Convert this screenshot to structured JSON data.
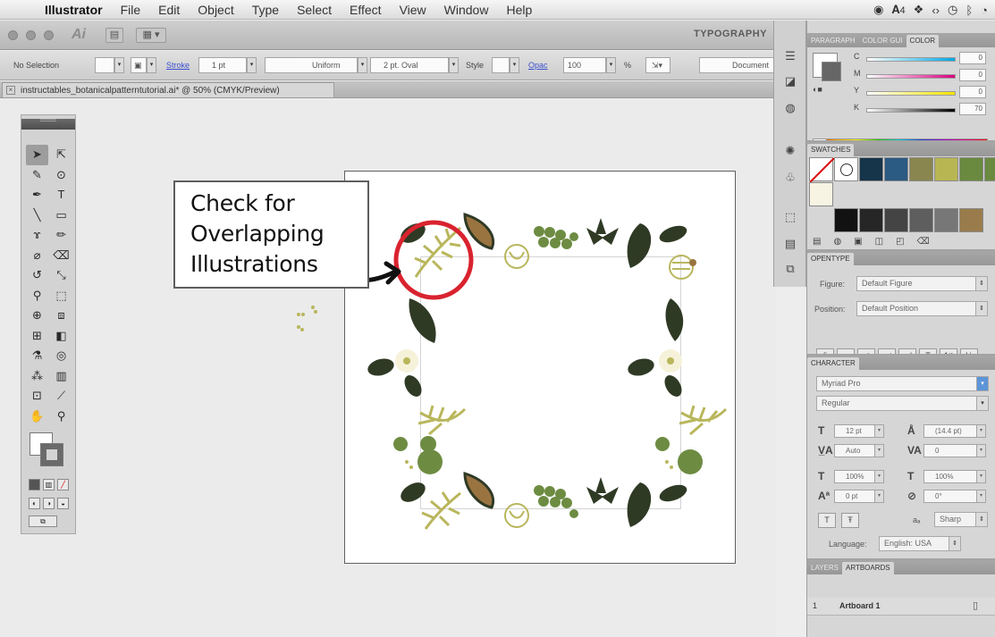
{
  "menubar": {
    "items": [
      "Illustrator",
      "File",
      "Edit",
      "Object",
      "Type",
      "Select",
      "Effect",
      "View",
      "Window",
      "Help"
    ],
    "tray_badge": "4"
  },
  "appbar": {
    "logo": "Ai",
    "workspace": "TYPOGRAPHY"
  },
  "control_bar": {
    "selection": "No Selection",
    "stroke_label": "Stroke",
    "stroke_weight": "1 pt",
    "profile": "Uniform",
    "brush": "2 pt. Oval",
    "style_label": "Style",
    "opacity_label": "Opac",
    "opacity_value": "100",
    "percent": "%",
    "document_button": "Document"
  },
  "document": {
    "tab_title": "instructables_botanicalpatterntutorial.ai* @ 50% (CMYK/Preview)"
  },
  "callout": {
    "lines": [
      "Check for",
      "Overlapping",
      "Illustrations"
    ]
  },
  "panels": {
    "top_tabs": [
      "PARAGRAPH",
      "COLOR GUI",
      "COLOR"
    ],
    "color": {
      "channels": [
        {
          "label": "C",
          "value": "0",
          "position": 0.0
        },
        {
          "label": "M",
          "value": "0",
          "position": 0.0
        },
        {
          "label": "Y",
          "value": "0",
          "position": 0.0
        },
        {
          "label": "K",
          "value": "70",
          "position": 0.7
        }
      ]
    },
    "swatches": {
      "title": "SWATCHES",
      "colors": [
        "#ffffff",
        "#2e3420",
        "#16344a",
        "#2b5a82",
        "#8a8650",
        "#b7b652",
        "#6a8a3f",
        "#f7f4e3",
        "#d7d7d7",
        "#121212",
        "#262626",
        "#444444",
        "#5e5e5e",
        "#777777",
        "#9a7c4c"
      ]
    },
    "opentype": {
      "title": "OPENTYPE",
      "figure_label": "Figure:",
      "figure_value": "Default Figure",
      "position_label": "Position:",
      "position_value": "Default Position"
    },
    "character": {
      "title": "CHARACTER",
      "font_family": "Myriad Pro",
      "font_style": "Regular",
      "size": "12 pt",
      "leading": "(14.4 pt)",
      "kerning": "Auto",
      "tracking": "0",
      "vscale": "100%",
      "hscale": "100%",
      "baseline": "0 pt",
      "rotation": "0°",
      "aa": "Sharp",
      "aa_label": "aₐ",
      "language_label": "Language:",
      "language": "English: USA"
    },
    "layers": {
      "tabs": [
        "LAYERS",
        "ARTBOARDS"
      ],
      "row_number": "1",
      "row_name": "Artboard 1"
    }
  },
  "colors": {
    "accent_red": "#d9232f",
    "dark_leaf": "#2f3a25",
    "olive_leaf": "#b9b65c",
    "green_leaf": "#6d8c42",
    "brown_leaf": "#9a7440"
  }
}
